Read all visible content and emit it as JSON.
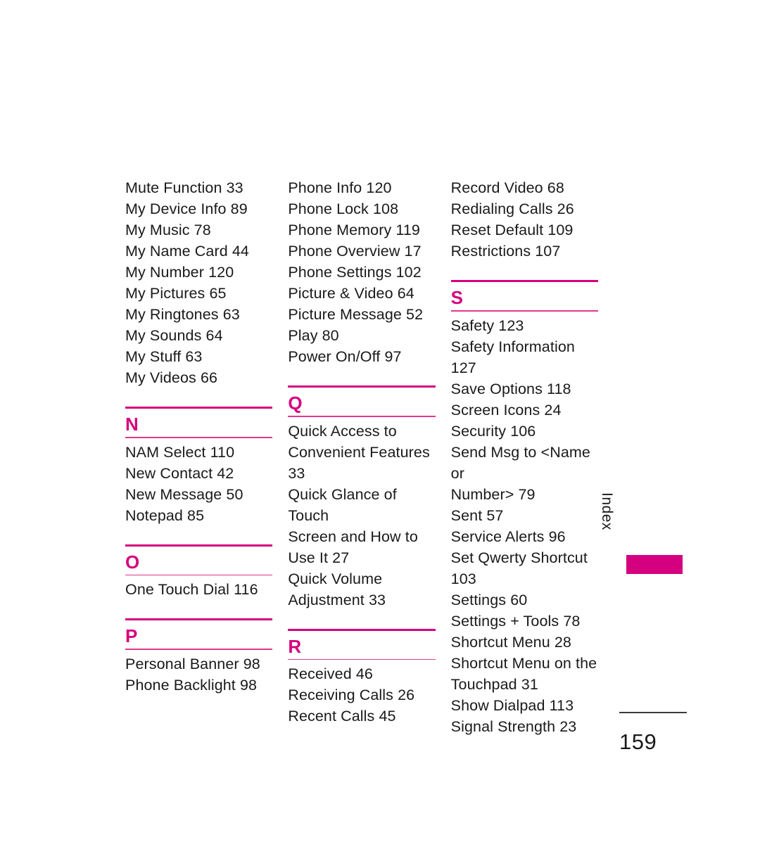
{
  "page": {
    "number": "159",
    "side_tab_label": "Index",
    "accent_color": "#d5007f",
    "text_color": "#1a1a1a"
  },
  "columns": [
    {
      "id": "column-1",
      "blocks": [
        {
          "type": "entries",
          "letter": "",
          "entries": [
            "Mute Function 33",
            "My Device Info 89",
            "My Music 78",
            "My Name Card 44",
            "My Number 120",
            "My Pictures 65",
            "My Ringtones 63",
            "My Sounds 64",
            "My Stuff 63",
            "My Videos 66"
          ]
        },
        {
          "type": "letter",
          "letter": "N",
          "entries": [
            "NAM Select 110",
            "New Contact 42",
            "New Message 50",
            "Notepad 85"
          ]
        },
        {
          "type": "letter",
          "letter": "O",
          "entries": [
            "One Touch Dial 116"
          ]
        },
        {
          "type": "letter",
          "letter": "P",
          "entries": [
            "Personal Banner 98",
            "Phone Backlight 98"
          ]
        }
      ]
    },
    {
      "id": "column-2",
      "blocks": [
        {
          "type": "entries",
          "letter": "",
          "entries": [
            "Phone Info 120",
            "Phone Lock 108",
            "Phone Memory 119",
            "Phone Overview 17",
            "Phone Settings 102",
            "Picture & Video 64",
            "Picture Message 52",
            "Play 80",
            "Power On/Off 97"
          ]
        },
        {
          "type": "letter",
          "letter": "Q",
          "entries": [
            "Quick Access to\nConvenient Features\n33",
            "Quick Glance of Touch\nScreen and How to\nUse It 27",
            "Quick Volume\nAdjustment 33"
          ]
        },
        {
          "type": "letter",
          "letter": "R",
          "entries": [
            "Received 46",
            "Receiving Calls 26",
            "Recent Calls 45"
          ]
        }
      ]
    },
    {
      "id": "column-3",
      "blocks": [
        {
          "type": "entries",
          "letter": "",
          "entries": [
            "Record Video 68",
            "Redialing Calls 26",
            "Reset Default 109",
            "Restrictions 107"
          ]
        },
        {
          "type": "letter",
          "letter": "S",
          "entries": [
            "Safety 123",
            "Safety Information 127",
            "Save Options 118",
            "Screen Icons 24",
            "Security 106",
            "Send Msg to <Name or\nNumber> 79",
            "Sent 57",
            "Service Alerts 96",
            "Set Qwerty Shortcut\n103",
            "Settings 60",
            "Settings + Tools 78",
            "Shortcut Menu 28",
            "Shortcut Menu on the\nTouchpad 31",
            "Show Dialpad 113",
            "Signal Strength 23"
          ]
        }
      ]
    }
  ]
}
